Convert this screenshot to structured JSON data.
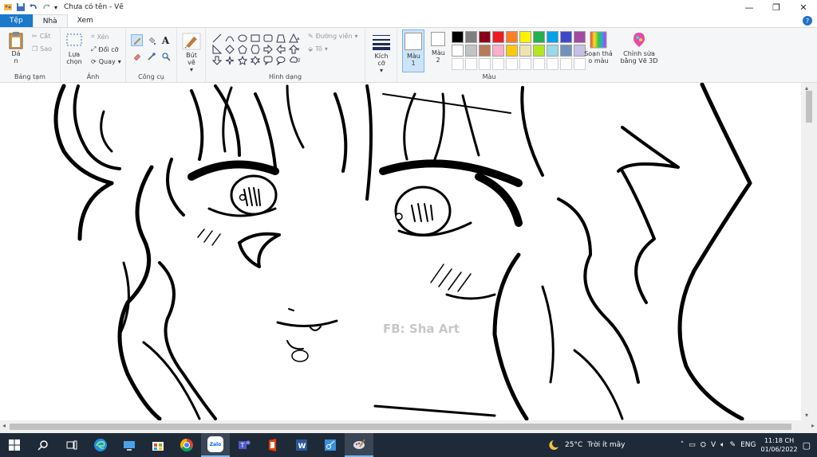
{
  "titlebar": {
    "title": "Chưa có tên - Vẽ"
  },
  "tabs": {
    "file": "Tệp",
    "home": "Nhà",
    "view": "Xem"
  },
  "ribbon": {
    "clipboard": {
      "paste_label": "Dá n",
      "cut": "Cắt",
      "copy": "Sao",
      "group": "Bảng tạm"
    },
    "image": {
      "select": "Lựa chọn",
      "crop": "Xén",
      "resize": "Đổi cỡ",
      "rotate": "Quay",
      "group": "Ảnh"
    },
    "tools": {
      "group": "Công cụ"
    },
    "brush": {
      "label": "Bút vẽ"
    },
    "shapes": {
      "outline": "Đường viền",
      "fill": "Tô",
      "group": "Hình dạng"
    },
    "size": {
      "label": "Kích cỡ"
    },
    "colors": {
      "color1": "Màu 1",
      "color2": "Màu 2",
      "edit_colors": "Soạn thả o màu",
      "paint3d": "Chỉnh sửa bằng Vẽ 3D",
      "group": "Màu",
      "row1": [
        "#000000",
        "#7f7f7f",
        "#880015",
        "#ed1c24",
        "#ff7f27",
        "#fff200",
        "#22b14c",
        "#00a2e8",
        "#3f48cc",
        "#a349a4"
      ],
      "row2": [
        "#ffffff",
        "#c3c3c3",
        "#b97a57",
        "#ffaec9",
        "#ffc90e",
        "#efe4b0",
        "#b5e61d",
        "#99d9ea",
        "#7092be",
        "#c8bfe7"
      ],
      "row3": [
        "#ffffff",
        "#ffffff",
        "#ffffff",
        "#ffffff",
        "#ffffff",
        "#ffffff",
        "#ffffff",
        "#ffffff",
        "#ffffff",
        "#ffffff"
      ]
    }
  },
  "canvas": {
    "watermark": "FB: Sha Art"
  },
  "taskbar": {
    "zalo": "Zalo",
    "weather_temp": "25°C",
    "weather_text": "Trời ít mây",
    "lang": "ENG",
    "time": "11:18 CH",
    "date": "01/06/2022"
  }
}
